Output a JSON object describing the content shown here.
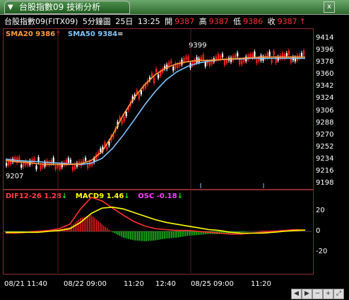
{
  "window": {
    "tab_title": "台股指數09 技術分析",
    "close_label": "x",
    "arrow_label": "▼"
  },
  "quote_bar": {
    "symbol": "台股指數09(FITX09)",
    "interval": "5分鐘圖",
    "day": "25日",
    "time": "13:25",
    "open_label": "開",
    "open": "9387",
    "high_label": "高",
    "high": "9387",
    "low_label": "低",
    "low": "9386",
    "close_label": "收",
    "close": "9387",
    "arrow": "↑"
  },
  "price_panel": {
    "sma20_label": "SMA20 9386",
    "sma20_arrow": "↑",
    "sma50_label": "SMA50 9384",
    "sma50_arrow": "=",
    "high_marker": "9399",
    "low_marker": "9207",
    "y_ticks": [
      "9414",
      "9396",
      "9378",
      "9360",
      "9342",
      "9324",
      "9306",
      "9288",
      "9270",
      "9252",
      "9234",
      "9216",
      "9198"
    ]
  },
  "macd_panel": {
    "dif_label": "DIF12-26 1.28",
    "dif_arrow": "↓",
    "macd_label": "MACD9 1.46",
    "macd_arrow": "↓",
    "osc_label": "OSC -0.18",
    "osc_arrow": "↓",
    "y_ticks": [
      "20",
      "0",
      "-20"
    ]
  },
  "x_axis": {
    "ticks": [
      "08/21 11:40",
      "08/22 09:00",
      "11:20",
      "12:40",
      "08/25 09:00",
      "11:20"
    ]
  },
  "colors": {
    "up": "#ff2020",
    "down": "#ffffff",
    "sma20": "#ff9a3c",
    "sma50": "#7fc6ff",
    "dif": "#ff3030",
    "macd": "#ffff00",
    "osc_pos": "#ff2020",
    "osc_neg": "#20d020",
    "frame": "#8a2a2a"
  },
  "icons": [
    "left-arrow-icon",
    "right-arrow-icon",
    "zoom-out-icon",
    "zoom-in-icon",
    "expand-icon"
  ],
  "chart_data": [
    {
      "type": "line",
      "title": "台股指數09(FITX09) 5分鐘圖",
      "ylim": [
        9198,
        9414
      ],
      "series": [
        {
          "name": "SMA20",
          "values": [
            9232,
            9230,
            9229,
            9227,
            9226,
            9226,
            9226,
            9227,
            9232,
            9245,
            9270,
            9300,
            9325,
            9345,
            9360,
            9370,
            9376,
            9379,
            9381,
            9381,
            9382,
            9383,
            9384,
            9385,
            9386,
            9386,
            9386,
            9386,
            9386
          ]
        },
        {
          "name": "SMA50",
          "values": [
            9234,
            9232,
            9231,
            9230,
            9229,
            9228,
            9227,
            9226,
            9228,
            9235,
            9250,
            9270,
            9292,
            9315,
            9335,
            9352,
            9364,
            9372,
            9377,
            9380,
            9382,
            9383,
            9383,
            9384,
            9384,
            9384,
            9384,
            9384,
            9384
          ]
        }
      ],
      "x_ticks": [
        "08/21 11:40",
        "08/22 09:00",
        "11:20",
        "12:40",
        "08/25 09:00",
        "11:20"
      ]
    },
    {
      "type": "line",
      "series": [
        {
          "name": "DIF12-26",
          "values": [
            -2,
            -2,
            -1,
            0,
            1,
            3,
            8,
            25,
            38,
            34,
            26,
            18,
            11,
            6,
            3,
            2,
            1,
            1,
            0,
            -1,
            -2,
            -3,
            -3,
            -2,
            -1,
            0,
            1,
            2,
            1.28
          ]
        },
        {
          "name": "MACD9",
          "values": [
            -1,
            -1,
            -1,
            -1,
            0,
            1,
            3,
            10,
            20,
            26,
            27,
            25,
            21,
            17,
            13,
            10,
            8,
            6,
            4,
            2,
            1,
            -1,
            -2,
            -2,
            -2,
            -1,
            0,
            1,
            1.46
          ]
        },
        {
          "name": "OSC",
          "values": [
            -1,
            -1,
            0,
            1,
            1,
            2,
            5,
            15,
            18,
            8,
            -1,
            -7,
            -10,
            -11,
            -10,
            -8,
            -7,
            -5,
            -4,
            -3,
            -3,
            -2,
            -1,
            0,
            1,
            1,
            1,
            1,
            -0.18
          ]
        }
      ],
      "ylim": [
        -30,
        30
      ]
    }
  ]
}
